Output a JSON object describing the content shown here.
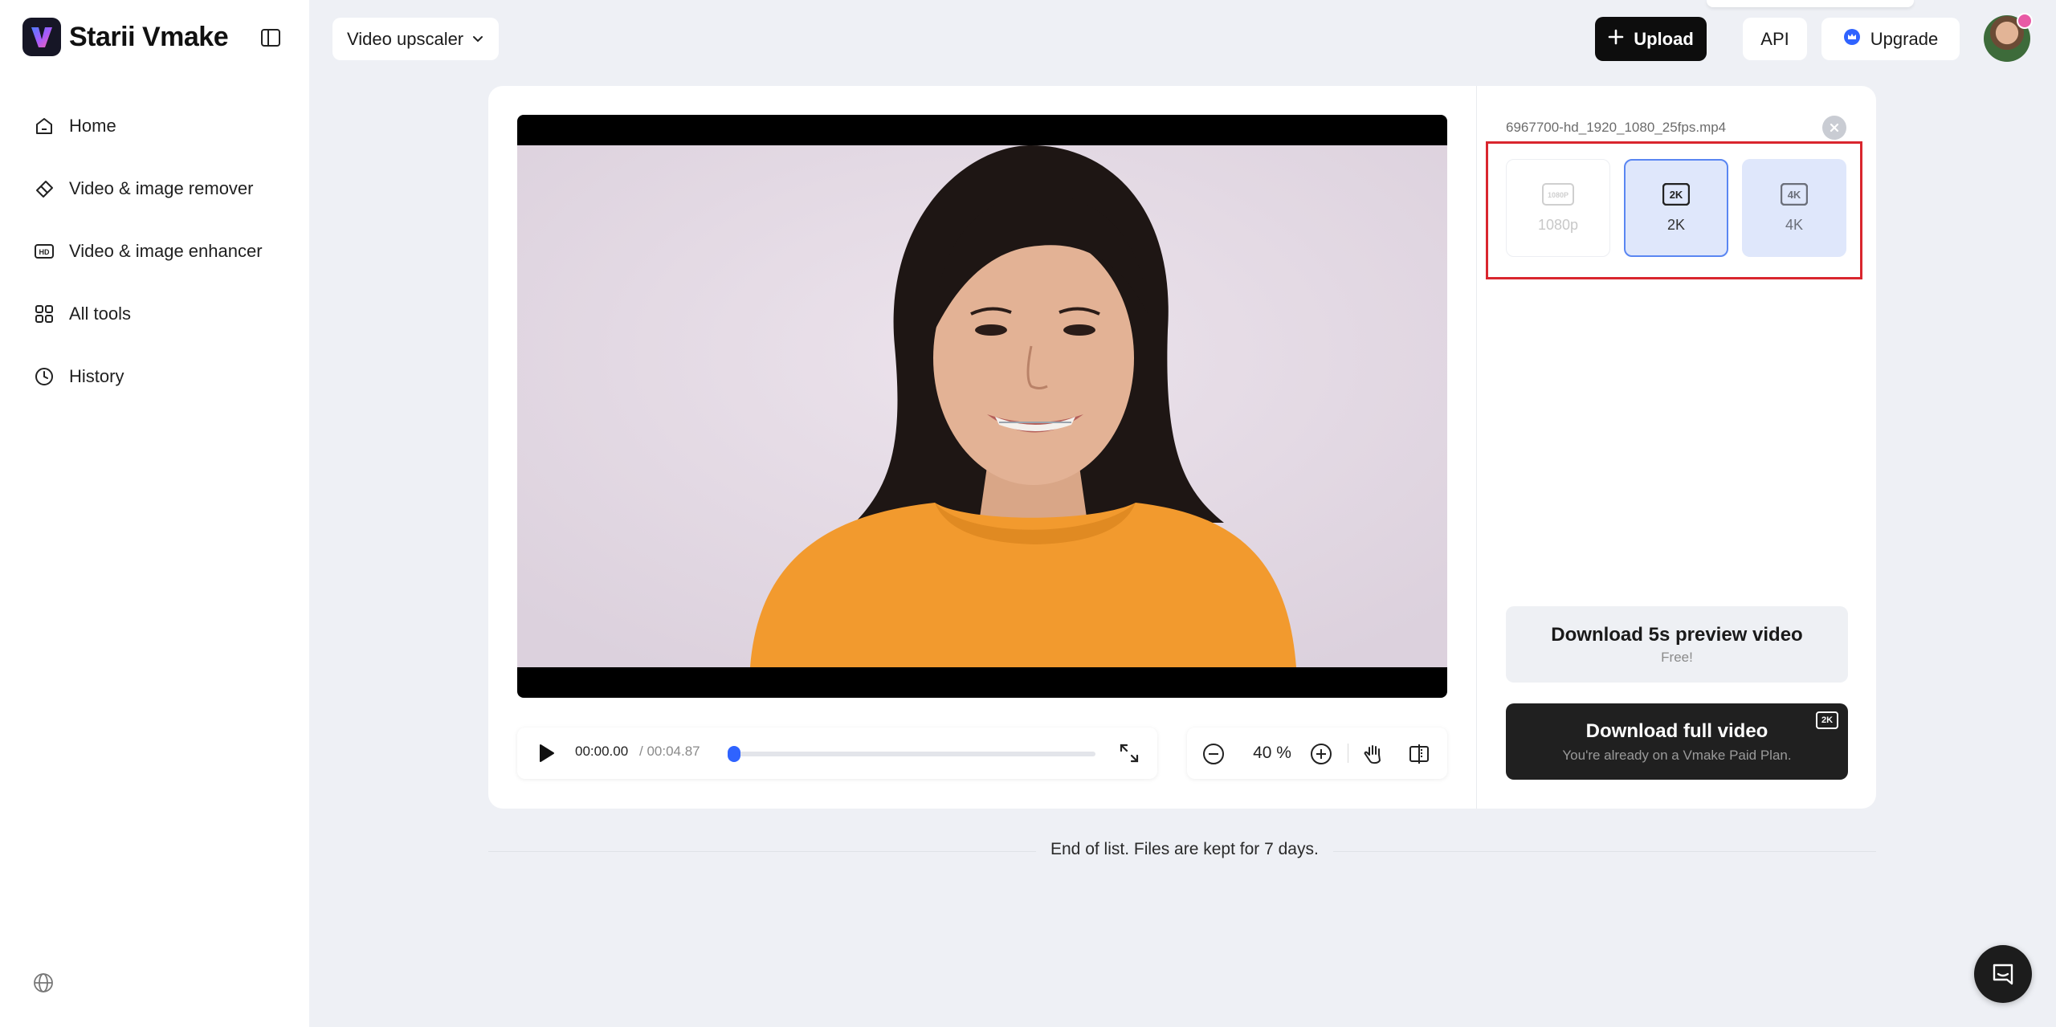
{
  "brand": {
    "name": "Starii Vmake"
  },
  "sidebar": {
    "items": [
      {
        "label": "Home",
        "icon": "home-icon"
      },
      {
        "label": "Video & image remover",
        "icon": "eraser-icon"
      },
      {
        "label": "Video & image enhancer",
        "icon": "hd-icon"
      },
      {
        "label": "All tools",
        "icon": "grid-icon"
      },
      {
        "label": "History",
        "icon": "clock-icon"
      }
    ]
  },
  "header": {
    "tool_select": "Video upscaler",
    "upload_label": "Upload",
    "api_label": "API",
    "upgrade_label": "Upgrade"
  },
  "player": {
    "current_time": "00:00.00",
    "total_time": "/ 00:04.87",
    "progress": 0.0,
    "zoom": "40 %"
  },
  "panel": {
    "file_name": "6967700-hd_1920_1080_25fps.mp4",
    "resolutions": [
      {
        "label": "1080p",
        "badge": "1080P",
        "state": "disabled"
      },
      {
        "label": "2K",
        "badge": "2K",
        "state": "selected"
      },
      {
        "label": "4K",
        "badge": "4K",
        "state": "available"
      }
    ],
    "preview_title": "Download 5s preview video",
    "preview_sub": "Free!",
    "full_title": "Download full video",
    "full_sub": "You're already on a Vmake Paid Plan.",
    "full_badge": "2K"
  },
  "footer": {
    "end_text": "End of list. Files are kept for 7 days."
  },
  "colors": {
    "accent": "#2f63ff",
    "highlight_border": "#d9262e",
    "selected_bg": "#dfe7fb",
    "dark_button": "#202020"
  }
}
